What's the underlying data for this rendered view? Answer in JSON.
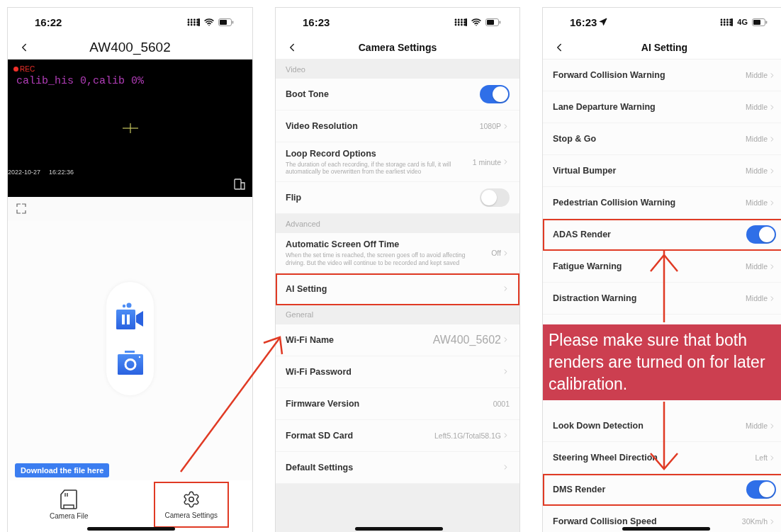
{
  "screens": [
    {
      "kind": "live_view",
      "status_bar": {
        "time": "16:22",
        "location": false,
        "network": {
          "kind": "wifi"
        }
      },
      "title": "AW400_5602",
      "video": {
        "rec": "REC",
        "osd": "calib_his 0,calib 0%",
        "date": "2022-10-27",
        "time": "16:22:36"
      },
      "tabs": [
        {
          "label": "Camera File",
          "tooltip": "Download the file here",
          "highlighted": false
        },
        {
          "label": "Camera Settings",
          "highlighted": true
        }
      ]
    },
    {
      "kind": "settings",
      "status_bar": {
        "time": "16:23",
        "location": false,
        "network": {
          "kind": "wifi"
        }
      },
      "title": "Camera Settings",
      "sections": [
        {
          "header": "Video",
          "items": [
            {
              "kind": "toggle",
              "label": "Boot Tone",
              "on": true,
              "highlighted": false
            },
            {
              "kind": "value",
              "label": "Video Resolution",
              "value": "1080P",
              "chevron": true,
              "highlighted": false
            },
            {
              "kind": "value",
              "label": "Loop Record Options",
              "description": "The duration of each recording, if the storage card is full, it will automatically be overwritten from the earliest video",
              "value": "1 minute",
              "chevron": true,
              "highlighted": false
            },
            {
              "kind": "toggle",
              "label": "Flip",
              "on": false,
              "highlighted": false
            }
          ]
        },
        {
          "header": "Advanced",
          "items": [
            {
              "kind": "value",
              "label": "Automatic Screen Off Time",
              "description": "When the set time is reached, the screen goes off to avoid affecting driving. But the video will continue to be recorded and kept saved",
              "value": "Off",
              "chevron": true,
              "highlighted": false
            },
            {
              "kind": "value",
              "label": "AI Setting",
              "chevron": true,
              "highlighted": true
            }
          ]
        },
        {
          "header": "General",
          "items": [
            {
              "kind": "value",
              "label": "Wi-Fi Name",
              "value": "AW400_5602",
              "large": true,
              "chevron": true,
              "highlighted": false
            },
            {
              "kind": "value",
              "label": "Wi-Fi Password",
              "chevron": true,
              "highlighted": false
            },
            {
              "kind": "value",
              "label": "Firmware Version",
              "value": "0001",
              "chevron": false,
              "highlighted": false
            },
            {
              "kind": "value",
              "label": "Format SD Card",
              "value": "Left5.1G/Total58.1G",
              "chevron": true,
              "highlighted": false
            },
            {
              "kind": "value",
              "label": "Default Settings",
              "chevron": true,
              "highlighted": false
            }
          ]
        }
      ]
    },
    {
      "kind": "settings",
      "status_bar": {
        "time": "16:23",
        "location": true,
        "network": {
          "kind": "cellular",
          "label": "4G"
        }
      },
      "title": "AI Setting",
      "sections": [
        {
          "items": [
            {
              "kind": "value",
              "label": "Forward Collision Warning",
              "value": "Middle",
              "chevron": true,
              "highlighted": false
            },
            {
              "kind": "value",
              "label": "Lane Departure Warning",
              "value": "Middle",
              "chevron": true,
              "highlighted": false
            },
            {
              "kind": "value",
              "label": "Stop & Go",
              "value": "Middle",
              "chevron": true,
              "highlighted": false
            },
            {
              "kind": "value",
              "label": "Virtual Bumper",
              "value": "Middle",
              "chevron": true,
              "highlighted": false
            },
            {
              "kind": "value",
              "label": "Pedestrian Collision Warning",
              "value": "Middle",
              "chevron": true,
              "highlighted": false
            },
            {
              "kind": "toggle",
              "label": "ADAS Render",
              "on": true,
              "highlighted": true
            },
            {
              "kind": "value",
              "label": "Fatigue Warning",
              "value": "Middle",
              "chevron": true,
              "highlighted": false
            },
            {
              "kind": "value",
              "label": "Distraction Warning",
              "value": "Middle",
              "chevron": true,
              "highlighted": false
            },
            {
              "kind": "callout",
              "text": "Please make sure that both renders are turned on for later calibration."
            },
            {
              "kind": "value",
              "label": "Look Down Detection",
              "value": "Middle",
              "chevron": true,
              "highlighted": false
            },
            {
              "kind": "value",
              "label": "Steering Wheel Direction",
              "value": "Left",
              "chevron": true,
              "highlighted": false
            },
            {
              "kind": "toggle",
              "label": "DMS Render",
              "on": true,
              "highlighted": true
            },
            {
              "kind": "value",
              "label": "Forward Collision Speed",
              "value": "30Km/h",
              "chevron": true,
              "highlighted": false
            }
          ]
        }
      ]
    }
  ]
}
